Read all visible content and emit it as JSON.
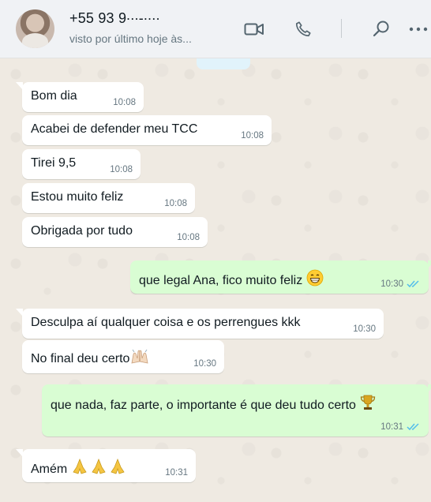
{
  "header": {
    "contact_name": "+55 93 9​​∙∙∙-∙∙∙∙",
    "status": "visto por último hoje às...",
    "icons": [
      "video-call-icon",
      "voice-call-icon",
      "search-icon",
      "menu-icon"
    ]
  },
  "messages": [
    {
      "direction": "in",
      "text": "Bom dia",
      "time": "10:08"
    },
    {
      "direction": "in",
      "text": "Acabei de defender meu TCC",
      "time": "10:08"
    },
    {
      "direction": "in",
      "text": "Tirei 9,5",
      "time": "10:08"
    },
    {
      "direction": "in",
      "text": "Estou muito feliz",
      "time": "10:08"
    },
    {
      "direction": "in",
      "text": "Obrigada por tudo",
      "time": "10:08"
    },
    {
      "direction": "out",
      "text": "que legal Ana, fico muito feliz",
      "emoji": "grinning-face",
      "time": "10:30",
      "status": "read"
    },
    {
      "direction": "in",
      "text": "Desculpa aí qualquer coisa e os perrengues kkk",
      "time": "10:30"
    },
    {
      "direction": "in",
      "text": "No final deu certo",
      "emoji": "raising-hands",
      "time": "10:30"
    },
    {
      "direction": "out",
      "text": "que nada, faz parte, o importante é que deu tudo certo",
      "emoji": "trophy",
      "time": "10:31",
      "status": "read"
    },
    {
      "direction": "in",
      "text": "Amém",
      "emoji": "praying-hands-x3",
      "time": "10:31"
    }
  ],
  "colors": {
    "header_bg": "#f0f2f5",
    "chat_bg": "#efeae2",
    "incoming_bubble": "#ffffff",
    "outgoing_bubble": "#d9fdd3",
    "read_ticks": "#53bdeb"
  }
}
